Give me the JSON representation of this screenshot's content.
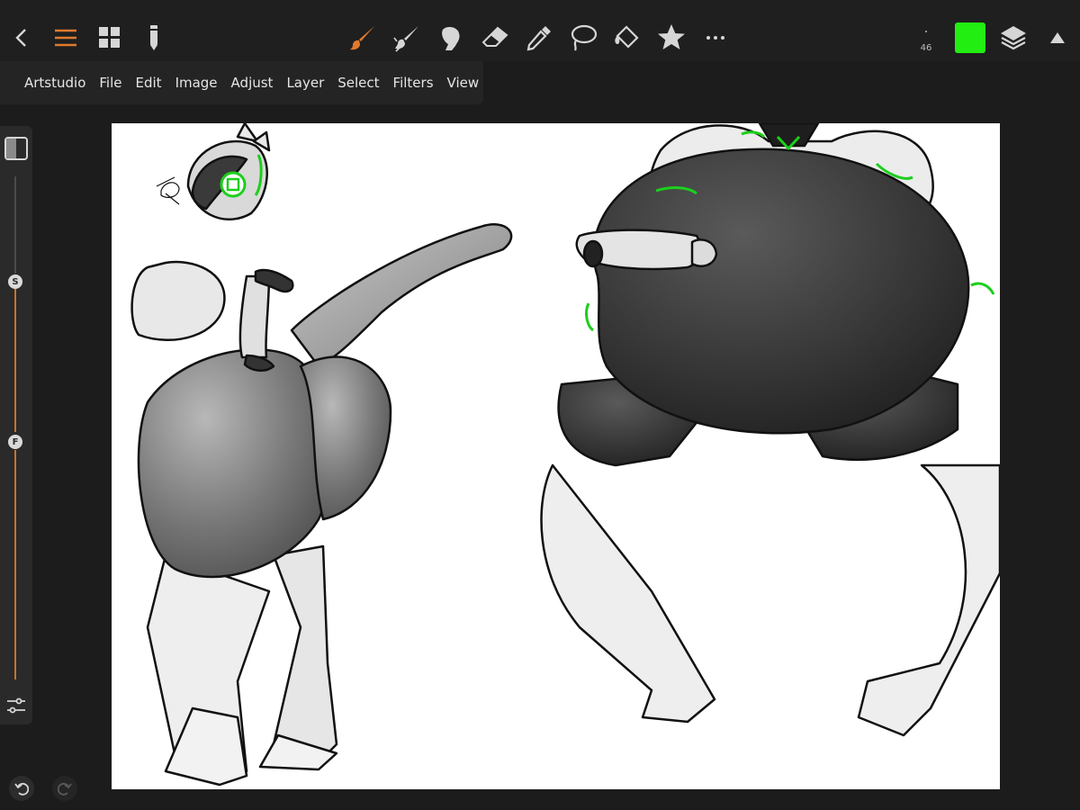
{
  "app": {
    "name": "Artstudio",
    "accent_color": "#e07a2e"
  },
  "toolbar": {
    "left_icons": [
      "back-chevron-icon",
      "menu-icon",
      "grid-icon",
      "pencil-icon"
    ],
    "tools": [
      "brush-icon",
      "smudge-icon",
      "stamp-icon",
      "eraser-icon",
      "eyedropper-icon",
      "lasso-icon",
      "fill-icon",
      "favorites-star-icon",
      "more-icon"
    ],
    "active_tool": "brush-icon",
    "brush_size": "46",
    "current_color": "#22ee11",
    "right_icons": [
      "layers-icon",
      "collapse-toolbar-icon"
    ]
  },
  "menu": {
    "items": [
      "Artstudio",
      "File",
      "Edit",
      "Image",
      "Adjust",
      "Layer",
      "Select",
      "Filters",
      "View"
    ]
  },
  "side_panel": {
    "size_slider_label": "S",
    "flow_slider_label": "F",
    "icons": [
      "split-view-icon",
      "slider-settings-icon"
    ]
  },
  "history": {
    "icons": [
      "undo-icon",
      "redo-icon"
    ]
  },
  "canvas": {
    "background": "#ffffff"
  }
}
